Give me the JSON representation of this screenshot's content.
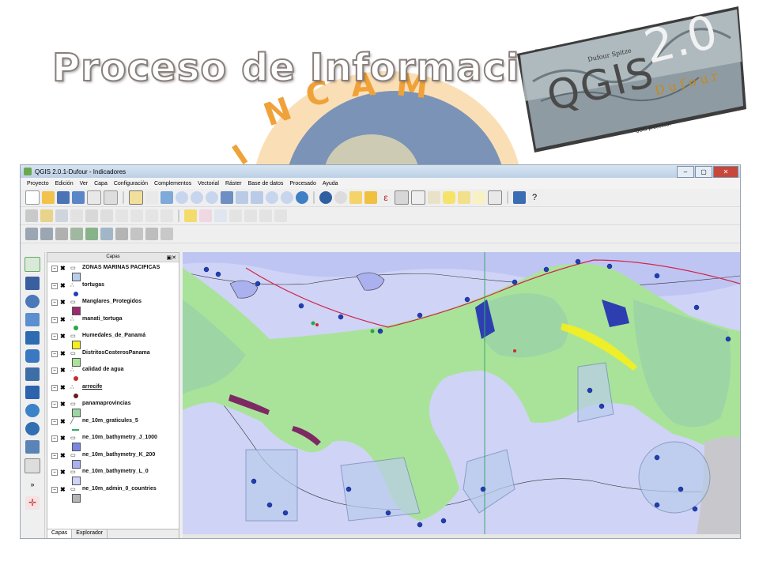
{
  "slide": {
    "title": "Proceso de Información",
    "qgis_badge": {
      "name": "QGIS",
      "version": "2.0",
      "codename": "Dufour"
    }
  },
  "window": {
    "title": "QGIS 2.0.1-Dufour - Indicadores",
    "controls": [
      "–",
      "▢",
      "✕"
    ]
  },
  "menubar": [
    "Proyecto",
    "Edición",
    "Ver",
    "Capa",
    "Configuración",
    "Complementos",
    "Vectorial",
    "Ráster",
    "Base de datos",
    "Procesado",
    "Ayuda"
  ],
  "layers_panel": {
    "title": "Capas",
    "tabs": [
      "Capas",
      "Explorador"
    ],
    "layers": [
      {
        "name": "ZONAS MARINAS PACIFICAS",
        "type": "polygon",
        "color": "#b9cdeb"
      },
      {
        "name": "tortugas",
        "type": "point",
        "color": "#1f3fb5"
      },
      {
        "name": "Manglares_Protegidos",
        "type": "polygon",
        "color": "#9b2a6e"
      },
      {
        "name": "manati_tortuga",
        "type": "point",
        "color": "#27a844"
      },
      {
        "name": "Humedales_de_Panamá",
        "type": "polygon",
        "color": "#f5ee1d"
      },
      {
        "name": "DistritosCosterosPanama",
        "type": "polygon",
        "color": "#a9e39a"
      },
      {
        "name": "calidad de agua",
        "type": "point",
        "color": "#cc2a2a"
      },
      {
        "name": "arrecife",
        "type": "point",
        "color": "#6b1a1a"
      },
      {
        "name": "panamaprovincias",
        "type": "polygon",
        "color": "#9dd6a4"
      },
      {
        "name": "ne_10m_graticules_5",
        "type": "line",
        "color": "#3aa86a"
      },
      {
        "name": "ne_10m_bathymetry_J_1000",
        "type": "polygon",
        "color": "#7a86e0"
      },
      {
        "name": "ne_10m_bathymetry_K_200",
        "type": "polygon",
        "color": "#aab1ee"
      },
      {
        "name": "ne_10m_bathymetry_L_0",
        "type": "polygon",
        "color": "#cfd3f6"
      },
      {
        "name": "ne_10m_admin_0_countries",
        "type": "polygon",
        "color": "#b5b5b5"
      }
    ]
  },
  "map": {
    "colors": {
      "sea_deep": "#aab1ee",
      "sea_shallow": "#cfd3f6",
      "land": "#a9e39a",
      "provinces": "#9dd6a4",
      "marine_zone": "#b9cdeb",
      "points": "#1f3fb5",
      "wetlands": "#f5ee1d",
      "mangroves": "#7d2a64",
      "countries": "#c8c8cc"
    }
  }
}
